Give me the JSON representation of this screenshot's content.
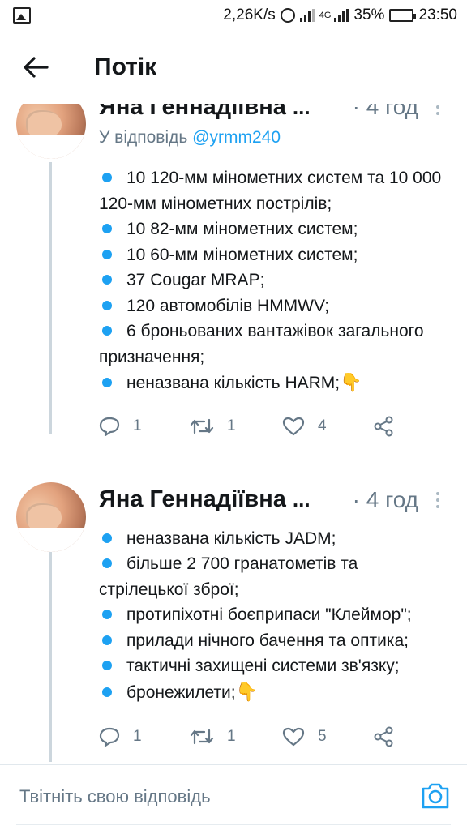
{
  "status_bar": {
    "speed": "2,26K/s",
    "network": "4G",
    "battery_percent": "35%",
    "battery_level": 0.35,
    "time": "23:50",
    "icons": [
      "gallery-icon",
      "alarm-icon",
      "signal-icon",
      "battery-icon"
    ]
  },
  "header": {
    "title": "Потік"
  },
  "tweets": [
    {
      "author": "Яна Геннадіївна",
      "ellipsis": "...",
      "time": "· 4 год",
      "reply_prefix": "У відповідь",
      "reply_handle": "@yrmm240",
      "lines": [
        "10 120-мм мінометних систем та 10 000 120-мм мінометних пострілів;",
        "10 82-мм мінометних систем;",
        "10 60-мм мінометних систем;",
        "37 Cougar MRAP;",
        "120 автомобілів HMMWV;",
        "6 броньованих вантажівок загального призначення;",
        "неназвана кількість HARM;"
      ],
      "emoji": "👇",
      "replies": "1",
      "retweets": "1",
      "likes": "4"
    },
    {
      "author": "Яна Геннадіївна",
      "ellipsis": "...",
      "time": "· 4 год",
      "lines": [
        "неназвана кількість JADM;",
        "більше 2 700 гранатометів та стрілецької зброї;",
        "протипіхотні боєприпаси \"Клеймор\";",
        "прилади нічного бачення та оптика;",
        "тактичні захищені системи зв'язку;",
        "бронежилети;"
      ],
      "emoji": "👇",
      "replies": "1",
      "retweets": "1",
      "likes": "5"
    }
  ],
  "reply_bar": {
    "placeholder": "Твітніть свою відповідь"
  },
  "colors": {
    "accent": "#1da1f2",
    "secondary_text": "#657786",
    "primary_text": "#14171a",
    "divider": "#e1e8ed"
  }
}
